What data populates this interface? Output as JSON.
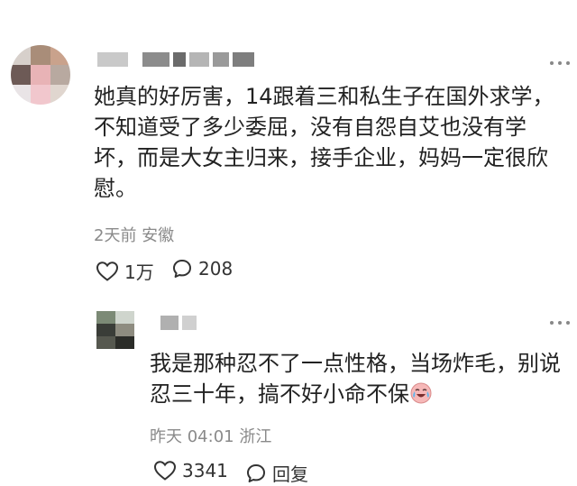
{
  "comment": {
    "avatar_colors": [
      "#d7d0cb",
      "#a98d79",
      "#c9a28c",
      "#6d5a56",
      "#e8b3b6",
      "#b8a9a0",
      "#e9e4e6",
      "#f1c7cd",
      "#e0d6cf"
    ],
    "text_lines": [
      "她真的好厉害，14跟着三和私生子在国外求学，",
      "不知道受了多少委屈，没有自怨自艾也没有学",
      "坏，而是大女主归来，接手企业，妈妈一定很欣",
      "慰。"
    ],
    "meta": "2天前 安徽",
    "likes": "1万",
    "replies_count": "208"
  },
  "reply": {
    "avatar_colors": [
      "#7c8a76",
      "#cfd5cd",
      "#3a3d38",
      "#8e8c80",
      "#56584f",
      "#2b2c28"
    ],
    "text_line1": "我是那种忍不了一点性格，当场炸毛，别说",
    "text_line2": "忍三十年，搞不好小命不保",
    "emoji_icon": "crying-laughing-face-icon",
    "meta": "昨天 04:01 浙江",
    "likes": "3341",
    "reply_label": "回复"
  }
}
